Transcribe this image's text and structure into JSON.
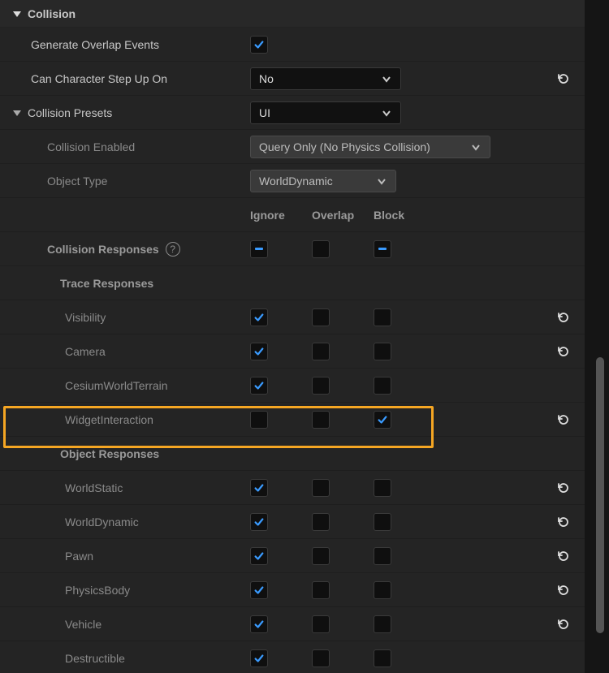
{
  "section": {
    "title": "Collision"
  },
  "props": {
    "generate_overlap_events": {
      "label": "Generate Overlap Events",
      "checked": true
    },
    "can_character_step_up": {
      "label": "Can Character Step Up On",
      "value": "No",
      "reset": true
    },
    "collision_presets": {
      "label": "Collision Presets",
      "value": "UI"
    },
    "collision_enabled": {
      "label": "Collision Enabled",
      "value": "Query Only (No Physics Collision)"
    },
    "object_type": {
      "label": "Object Type",
      "value": "WorldDynamic"
    }
  },
  "response_headers": {
    "ignore": "Ignore",
    "overlap": "Overlap",
    "block": "Block"
  },
  "collision_responses": {
    "label": "Collision Responses",
    "ignore": "indeterminate",
    "overlap": "unchecked",
    "block": "indeterminate"
  },
  "trace_responses": {
    "label": "Trace Responses",
    "rows": [
      {
        "label": "Visibility",
        "state": "ignore",
        "reset": true
      },
      {
        "label": "Camera",
        "state": "ignore",
        "reset": true
      },
      {
        "label": "CesiumWorldTerrain",
        "state": "ignore",
        "reset": false
      },
      {
        "label": "WidgetInteraction",
        "state": "block",
        "reset": true
      }
    ]
  },
  "object_responses": {
    "label": "Object Responses",
    "rows": [
      {
        "label": "WorldStatic",
        "state": "ignore",
        "reset": true
      },
      {
        "label": "WorldDynamic",
        "state": "ignore",
        "reset": true
      },
      {
        "label": "Pawn",
        "state": "ignore",
        "reset": true
      },
      {
        "label": "PhysicsBody",
        "state": "ignore",
        "reset": true
      },
      {
        "label": "Vehicle",
        "state": "ignore",
        "reset": true
      },
      {
        "label": "Destructible",
        "state": "ignore",
        "reset": false
      }
    ]
  }
}
